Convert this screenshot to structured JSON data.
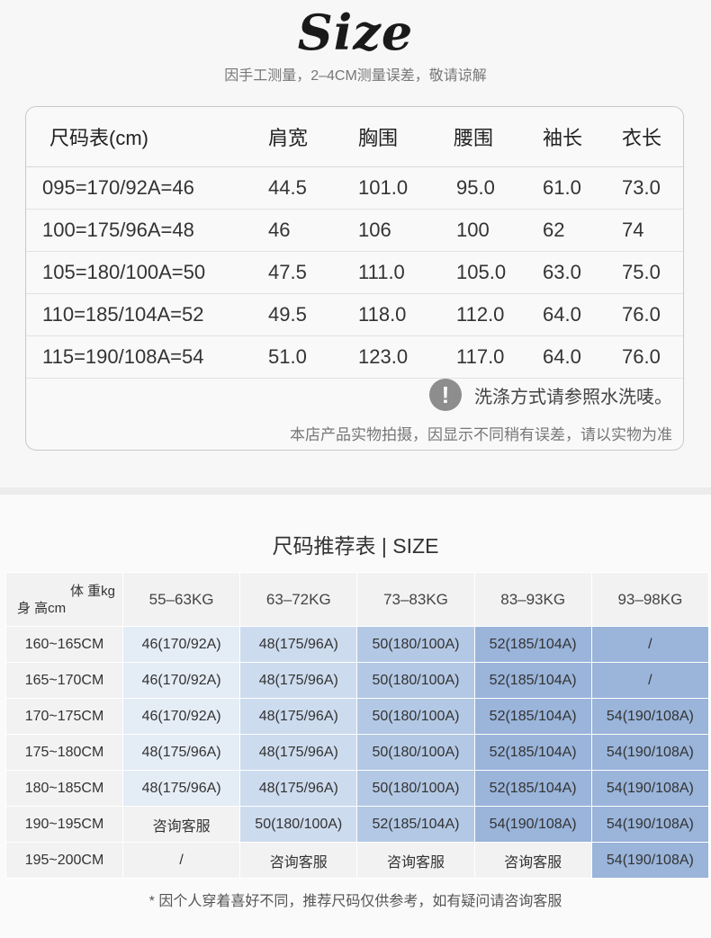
{
  "header": {
    "brand": "Size",
    "note": "因手工测量，2–4CM测量误差，敬请谅解"
  },
  "size_table": {
    "headers": [
      "尺码表(cm)",
      "肩宽",
      "胸围",
      "腰围",
      "袖长",
      "衣长"
    ],
    "rows": [
      [
        "095=170/92A=46",
        "44.5",
        "101.0",
        "95.0",
        "61.0",
        "73.0"
      ],
      [
        "100=175/96A=48",
        "46",
        "106",
        "100",
        "62",
        "74"
      ],
      [
        "105=180/100A=50",
        "47.5",
        "111.0",
        "105.0",
        "63.0",
        "75.0"
      ],
      [
        "110=185/104A=52",
        "49.5",
        "118.0",
        "112.0",
        "64.0",
        "76.0"
      ],
      [
        "115=190/108A=54",
        "51.0",
        "123.0",
        "117.0",
        "64.0",
        "76.0"
      ]
    ],
    "wash_note": "洗涤方式请参照水洗唛。",
    "warn_glyph": "!",
    "disclaimer": "本店产品实物拍摄，因显示不同稍有误差，请以实物为准"
  },
  "recommend": {
    "title": "尺码推荐表 | SIZE",
    "corner_weight": "体 重kg",
    "corner_height": "身 高cm",
    "weight_cols": [
      "55–63KG",
      "63–72KG",
      "73–83KG",
      "83–93KG",
      "93–98KG"
    ],
    "rows": [
      {
        "height": "160~165CM",
        "cells": [
          "46(170/92A)",
          "48(175/96A)",
          "50(180/100A)",
          "52(185/104A)",
          "/"
        ]
      },
      {
        "height": "165~170CM",
        "cells": [
          "46(170/92A)",
          "48(175/96A)",
          "50(180/100A)",
          "52(185/104A)",
          "/"
        ]
      },
      {
        "height": "170~175CM",
        "cells": [
          "46(170/92A)",
          "48(175/96A)",
          "50(180/100A)",
          "52(185/104A)",
          "54(190/108A)"
        ]
      },
      {
        "height": "175~180CM",
        "cells": [
          "48(175/96A)",
          "48(175/96A)",
          "50(180/100A)",
          "52(185/104A)",
          "54(190/108A)"
        ]
      },
      {
        "height": "180~185CM",
        "cells": [
          "48(175/96A)",
          "48(175/96A)",
          "50(180/100A)",
          "52(185/104A)",
          "54(190/108A)"
        ]
      },
      {
        "height": "190~195CM",
        "cells": [
          "咨询客服",
          "50(180/100A)",
          "52(185/104A)",
          "54(190/108A)",
          "54(190/108A)"
        ]
      },
      {
        "height": "195~200CM",
        "cells": [
          "/",
          "咨询客服",
          "咨询客服",
          "咨询客服",
          "54(190/108A)"
        ]
      }
    ],
    "footnote": "* 因个人穿着喜好不同，推荐尺码仅供参考，如有疑问请咨询客服"
  },
  "colors": {
    "page_bg": "#f7f7f7",
    "shade_1": "#e4ecf6",
    "shade_2": "#cddbee",
    "shade_3": "#b3c8e4",
    "shade_4": "#9ab4da",
    "neutral": "#f2f2f2"
  }
}
